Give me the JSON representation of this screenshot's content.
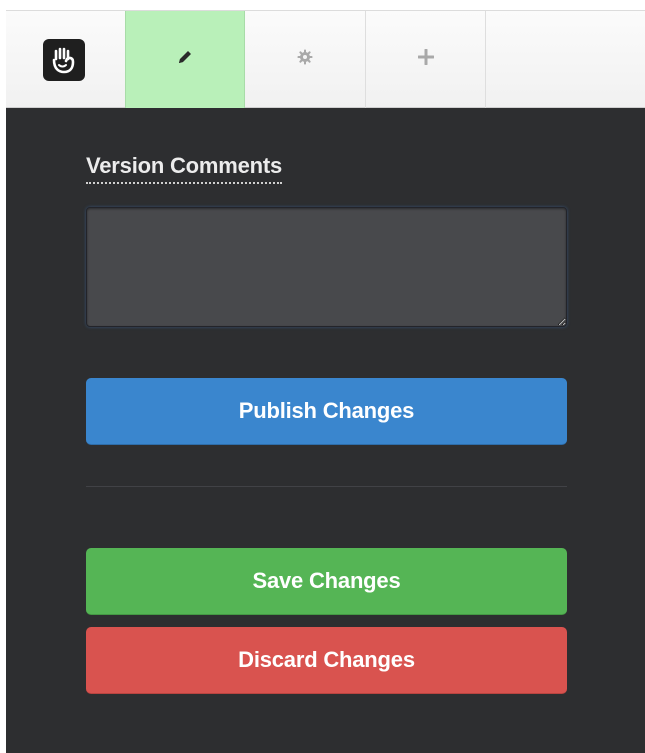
{
  "toolbar": {
    "items": [
      {
        "name": "concrete5-logo",
        "icon": "hand-logo-icon"
      },
      {
        "name": "edit",
        "icon": "pencil-icon",
        "active": true
      },
      {
        "name": "settings",
        "icon": "gear-icon"
      },
      {
        "name": "add",
        "icon": "plus-icon"
      }
    ]
  },
  "panel": {
    "version_comments_label": "Version Comments",
    "version_comments_value": "",
    "publish_label": "Publish Changes",
    "save_label": "Save Changes",
    "discard_label": "Discard Changes"
  },
  "colors": {
    "active_tab": "#b9f0b9",
    "panel_bg": "#2d2e30",
    "publish": "#3a86ce",
    "save": "#55b555",
    "discard": "#d9534f"
  }
}
